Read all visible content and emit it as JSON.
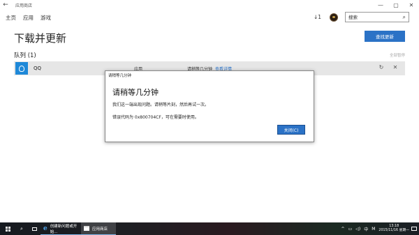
{
  "window": {
    "back_glyph": "←",
    "title": "应用商店",
    "min_glyph": "—",
    "max_glyph": "▢",
    "close_glyph": "✕"
  },
  "nav": {
    "items": [
      "主页",
      "应用",
      "游戏"
    ],
    "download_count": "↓1",
    "search_placeholder": "搜索",
    "search_glyph": "⌕"
  },
  "page": {
    "title": "下载并更新",
    "check_updates_label": "查找更新",
    "queue_label": "队列 (1)",
    "pause_all_label": "全部暂停"
  },
  "queue": [
    {
      "name": "QQ",
      "category": "应用",
      "status": "请稍等几分钟",
      "details_link": "查看详情",
      "retry_glyph": "↻",
      "remove_glyph": "✕"
    }
  ],
  "dialog": {
    "title": "请稍等几分钟",
    "heading": "请稍等几分钟",
    "message": "我们这一端出现问题。请稍等片刻，然后再试一次。",
    "error_text": "错误代码为 0x800704CF，可在需要时使用。",
    "close_label": "关闭(C)"
  },
  "taskbar": {
    "search_glyph": "⌕",
    "apps": [
      {
        "label": "创建新问题或开始...",
        "glyph": "e"
      },
      {
        "label": "应用商店",
        "glyph": ""
      }
    ],
    "tray": {
      "up_glyph": "^",
      "network_glyph": "▭",
      "volume_glyph": "◁)",
      "ime_label": "中",
      "ime_mode": "M",
      "time": "13:18",
      "date": "2015/11/16 星期一"
    }
  },
  "colors": {
    "accent": "#2b72c6",
    "queue_row_bg": "#e6e6e6",
    "app_icon_bg": "#1e88d8"
  }
}
